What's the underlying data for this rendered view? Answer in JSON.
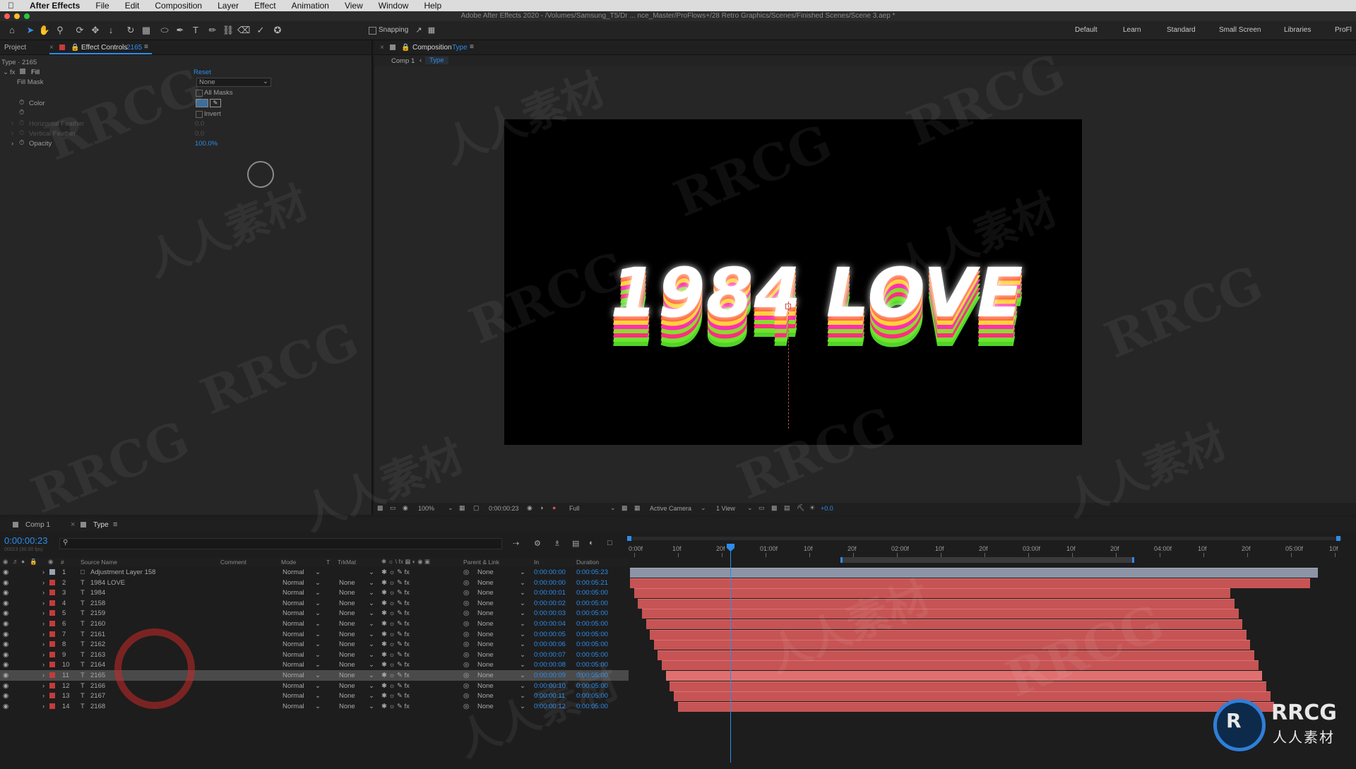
{
  "menubar": {
    "app": "After Effects",
    "items": [
      "File",
      "Edit",
      "Composition",
      "Layer",
      "Effect",
      "Animation",
      "View",
      "Window",
      "Help"
    ]
  },
  "window_title": "Adobe After Effects 2020 - /Volumes/Samsung_T5/Dr ... nce_Master/ProFlows+/28 Retro Graphics/Scenes/Finished Scenes/Scene 3.aep *",
  "toolbar": {
    "snapping_label": "Snapping",
    "workspaces": [
      "Default",
      "Learn",
      "Standard",
      "Small Screen",
      "Libraries",
      "ProFl"
    ]
  },
  "left_panel": {
    "tab_project": "Project",
    "tab_effect_controls": "Effect Controls",
    "tab_effect_layer": "2165",
    "layer_path": "Type · 2165",
    "effect_name": "Fill",
    "reset_label": "Reset",
    "fill_mask_label": "Fill Mask",
    "fill_mask_value": "None",
    "all_masks_label": "All Masks",
    "color_label": "Color",
    "color_value": "#3d6f9a",
    "invert_label": "Invert",
    "hfeather_label": "Horizontal Feather",
    "hfeather_value": "0.0",
    "vfeather_label": "Vertical Feather",
    "vfeather_value": "0.0",
    "opacity_label": "Opacity",
    "opacity_value": "100.0%"
  },
  "composition": {
    "panel_title": "Composition",
    "comp_name": "Type",
    "breadcrumb_parent": "Comp 1",
    "breadcrumb_current": "Type",
    "canvas_text": "1984 LOVE",
    "zoom": "100%",
    "timecode": "0:00:00:23",
    "resolution": "Full",
    "camera": "Active Camera",
    "views": "1 View",
    "exposure": "+0.0"
  },
  "timeline": {
    "tab_comp1": "Comp 1",
    "tab_type": "Type",
    "current_time": "0:00:00:23",
    "fps_note": "00023 (30.00 fps)",
    "columns": {
      "num": "#",
      "source_name": "Source Name",
      "comment": "Comment",
      "mode": "Mode",
      "t": "T",
      "trkmat": "TrkMat",
      "parent": "Parent & Link",
      "in": "In",
      "duration": "Duration"
    },
    "ruler_labels": [
      "0:00f",
      "10f",
      "20f",
      "01:00f",
      "10f",
      "20f",
      "02:00f",
      "10f",
      "20f",
      "03:00f",
      "10f",
      "20f",
      "04:00f",
      "10f",
      "20f",
      "05:00f",
      "10f"
    ],
    "layers": [
      {
        "num": "1",
        "name": "Adjustment Layer 158",
        "mode": "Normal",
        "trkmat": "",
        "parent": "None",
        "in": "0:00:00:00",
        "duration": "0:00:05:23"
      },
      {
        "num": "2",
        "name": "1984 LOVE",
        "mode": "Normal",
        "trkmat": "None",
        "parent": "None",
        "in": "0:00:00:00",
        "duration": "0:00:05:21"
      },
      {
        "num": "3",
        "name": "1984",
        "mode": "Normal",
        "trkmat": "None",
        "parent": "None",
        "in": "0:00:00:01",
        "duration": "0:00:05:00"
      },
      {
        "num": "4",
        "name": "2158",
        "mode": "Normal",
        "trkmat": "None",
        "parent": "None",
        "in": "0:00:00:02",
        "duration": "0:00:05:00"
      },
      {
        "num": "5",
        "name": "2159",
        "mode": "Normal",
        "trkmat": "None",
        "parent": "None",
        "in": "0:00:00:03",
        "duration": "0:00:05:00"
      },
      {
        "num": "6",
        "name": "2160",
        "mode": "Normal",
        "trkmat": "None",
        "parent": "None",
        "in": "0:00:00:04",
        "duration": "0:00:05:00"
      },
      {
        "num": "7",
        "name": "2161",
        "mode": "Normal",
        "trkmat": "None",
        "parent": "None",
        "in": "0:00:00:05",
        "duration": "0:00:05:00"
      },
      {
        "num": "8",
        "name": "2162",
        "mode": "Normal",
        "trkmat": "None",
        "parent": "None",
        "in": "0:00:00:06",
        "duration": "0:00:05:00"
      },
      {
        "num": "9",
        "name": "2163",
        "mode": "Normal",
        "trkmat": "None",
        "parent": "None",
        "in": "0:00:00:07",
        "duration": "0:00:05:00"
      },
      {
        "num": "10",
        "name": "2164",
        "mode": "Normal",
        "trkmat": "None",
        "parent": "None",
        "in": "0:00:00:08",
        "duration": "0:00:05:00"
      },
      {
        "num": "11",
        "name": "2165",
        "mode": "Normal",
        "trkmat": "None",
        "parent": "None",
        "in": "0:00:00:09",
        "duration": "0:00:05:00"
      },
      {
        "num": "12",
        "name": "2166",
        "mode": "Normal",
        "trkmat": "None",
        "parent": "None",
        "in": "0:00:00:10",
        "duration": "0:00:05:00"
      },
      {
        "num": "13",
        "name": "2167",
        "mode": "Normal",
        "trkmat": "None",
        "parent": "None",
        "in": "0:00:00:11",
        "duration": "0:00:05:00"
      },
      {
        "num": "14",
        "name": "2168",
        "mode": "Normal",
        "trkmat": "None",
        "parent": "None",
        "in": "0:00:00:12",
        "duration": "0:00:05:00"
      }
    ],
    "selected_layer": "11"
  },
  "watermark": {
    "text": "RRCG",
    "text_cn": "人人素材"
  }
}
